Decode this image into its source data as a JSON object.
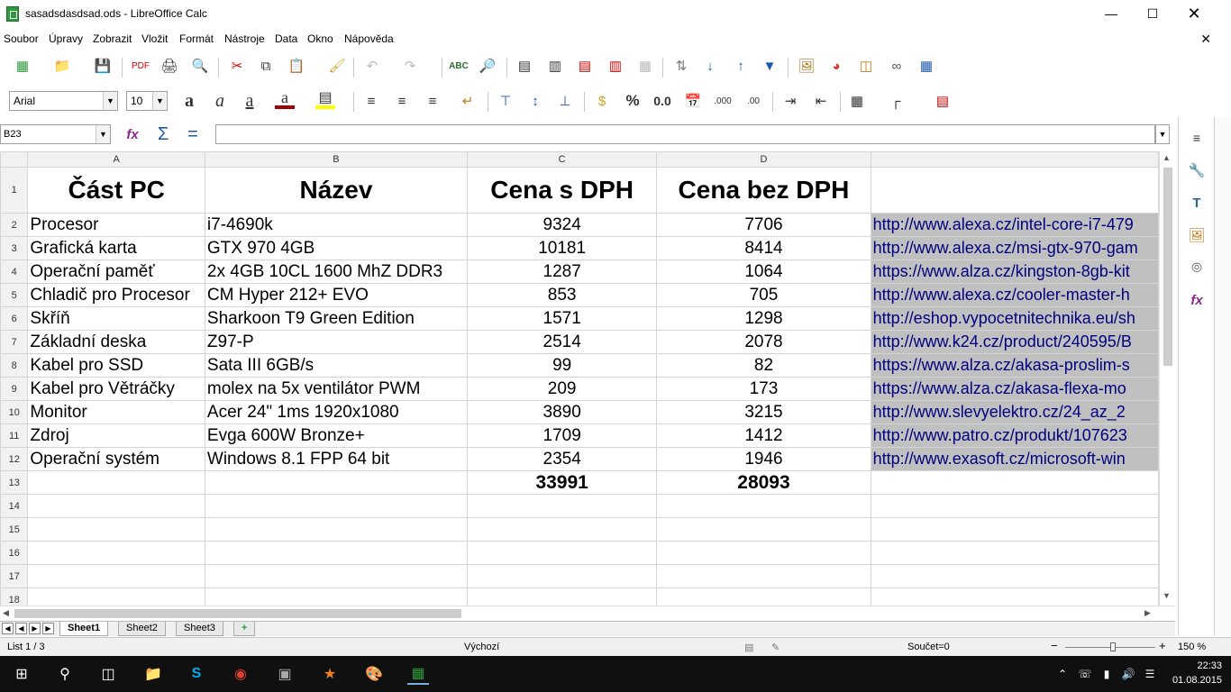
{
  "window": {
    "title": "sasadsdasdsad.ods - LibreOffice Calc"
  },
  "menu": [
    "Soubor",
    "Úpravy",
    "Zobrazit",
    "Vložit",
    "Formát",
    "Nástroje",
    "Data",
    "Okno",
    "Nápověda"
  ],
  "format_bar": {
    "font_name": "Arial",
    "font_size": "10"
  },
  "formula_bar": {
    "name_box": "B23",
    "formula": ""
  },
  "columns": [
    "A",
    "B",
    "C",
    "D"
  ],
  "row_numbers": [
    "1",
    "2",
    "3",
    "4",
    "5",
    "6",
    "7",
    "8",
    "9",
    "10",
    "11",
    "12",
    "13",
    "14",
    "15",
    "16",
    "17",
    "18"
  ],
  "header_row": [
    "Část PC",
    "Název",
    "Cena s DPH",
    "Cena bez DPH"
  ],
  "rows": [
    [
      "Procesor",
      "i7-4690k",
      "9324",
      "7706",
      "http://www.alexa.cz/intel-core-i7-479"
    ],
    [
      "Grafická karta",
      "GTX 970 4GB",
      "10181",
      "8414",
      "http://www.alexa.cz/msi-gtx-970-gam"
    ],
    [
      "Operační paměť",
      "2x 4GB 10CL 1600 MhZ DDR3",
      "1287",
      "1064",
      "https://www.alza.cz/kingston-8gb-kit"
    ],
    [
      "Chladič pro Procesor",
      "CM Hyper 212+ EVO",
      "853",
      "705",
      "http://www.alexa.cz/cooler-master-h"
    ],
    [
      "Skříň",
      "Sharkoon T9 Green Edition",
      "1571",
      "1298",
      "http://eshop.vypocetnitechnika.eu/sh"
    ],
    [
      "Základní deska",
      "Z97-P",
      "2514",
      "2078",
      "http://www.k24.cz/product/240595/B"
    ],
    [
      "Kabel pro SSD",
      "Sata III 6GB/s",
      "99",
      "82",
      "https://www.alza.cz/akasa-proslim-s"
    ],
    [
      "Kabel pro Větráčky",
      "molex na 5x ventilátor PWM",
      "209",
      "173",
      "https://www.alza.cz/akasa-flexa-mo"
    ],
    [
      "Monitor",
      "Acer 24\" 1ms 1920x1080",
      "3890",
      "3215",
      "http://www.slevyelektro.cz/24_az_2"
    ],
    [
      "Zdroj",
      "Evga 600W Bronze+",
      "1709",
      "1412",
      "http://www.patro.cz/produkt/107623"
    ],
    [
      "Operační systém",
      "Windows 8.1 FPP 64 bit",
      "2354",
      "1946",
      "http://www.exasoft.cz/microsoft-win"
    ]
  ],
  "totals": [
    "33991",
    "28093"
  ],
  "sheet_tabs": [
    "Sheet1",
    "Sheet2",
    "Sheet3"
  ],
  "status": {
    "sheet_position": "List 1 / 3",
    "page_style": "Výchozí",
    "sum": "Součet=0",
    "zoom": "150 %"
  },
  "taskbar": {
    "time": "22:33",
    "date": "01.08.2015"
  }
}
